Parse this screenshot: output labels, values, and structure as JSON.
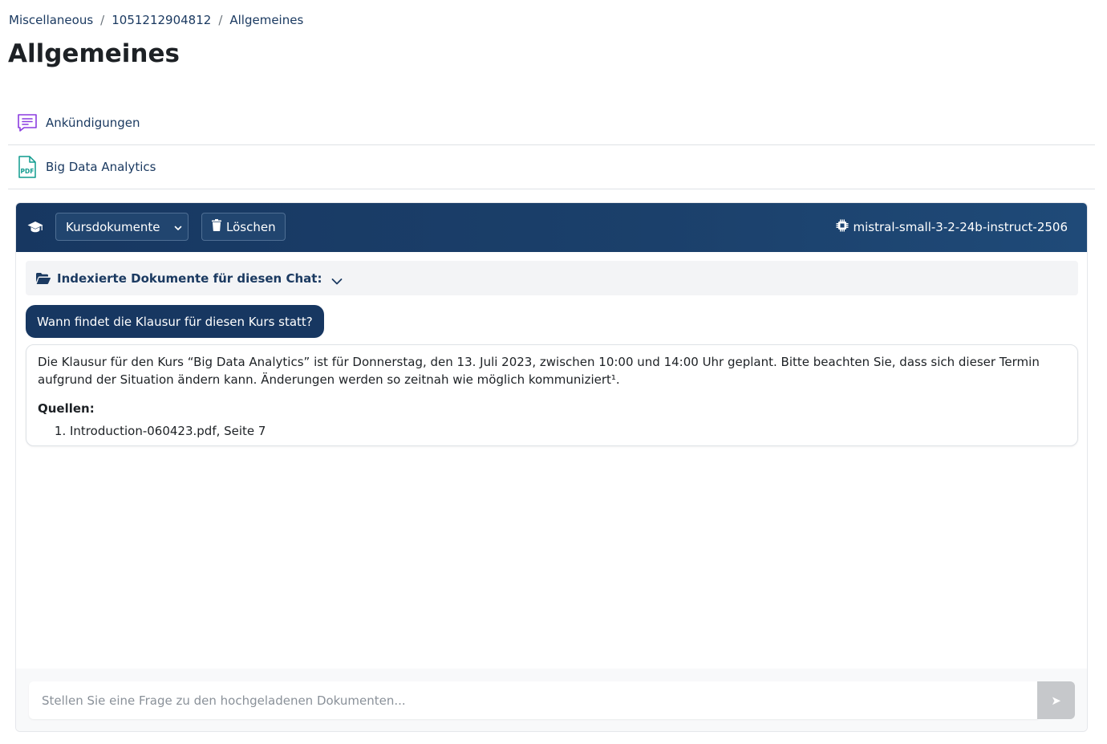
{
  "breadcrumb": {
    "items": [
      "Miscellaneous",
      "1051212904812",
      "Allgemeines"
    ],
    "separator": "/"
  },
  "page_title": "Allgemeines",
  "activities": [
    {
      "label": "Ankündigungen",
      "icon": "forum-icon"
    },
    {
      "label": "Big Data Analytics",
      "icon": "pdf-icon"
    }
  ],
  "chat": {
    "header": {
      "icon": "graduation-cap-icon",
      "select_value": "Kursdokumente",
      "delete_label": "Löschen",
      "model_name": "mistral-small-3-2-24b-instruct-2506"
    },
    "docs_toggle_label": "Indexierte Dokumente für diesen Chat:",
    "messages": {
      "user": "Wann findet die Klausur für diesen Kurs statt?",
      "bot_text": "Die Klausur für den Kurs “Big Data Analytics” ist für Donnerstag, den 13. Juli 2023, zwischen 10:00 und 14:00 Uhr geplant. Bitte beachten Sie, dass sich dieser Termin aufgrund der Situation ändern kann. Änderungen werden so zeitnah wie möglich kommuniziert¹.",
      "sources_title": "Quellen:",
      "sources": [
        "Introduction-060423.pdf, Seite 7"
      ]
    },
    "input_placeholder": "Stellen Sie eine Frage zu den hochgeladenen Dokumenten...",
    "send_label": "➤"
  },
  "colors": {
    "header_bg": "#173761",
    "user_bubble": "#173761",
    "link": "#1b3a61",
    "forum_icon": "#8b3ce0",
    "pdf_icon": "#0f9b8e",
    "send_disabled": "#c6c8cb"
  }
}
